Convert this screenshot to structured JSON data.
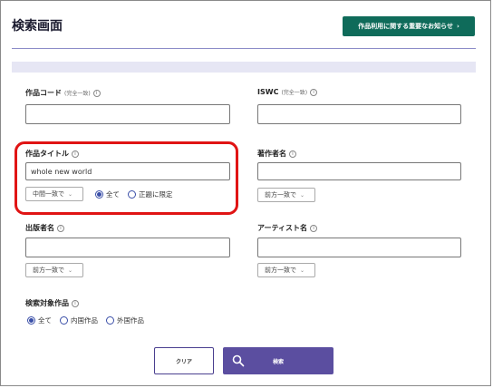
{
  "header": {
    "title": "検索画面",
    "notice_button": "作品利用に関する重要なお知らせ",
    "notice_arrow": "›"
  },
  "form": {
    "info_glyph": "i",
    "work_code": {
      "label": "作品コード",
      "note": "(完全一致)",
      "value": ""
    },
    "iswc": {
      "label": "ISWC",
      "note": "(完全一致)",
      "value": ""
    },
    "work_title": {
      "label": "作品タイトル",
      "value": "whole new world",
      "match_select": "中間一致で",
      "options": [
        "全て",
        "正題に限定"
      ],
      "selected": "全て"
    },
    "author": {
      "label": "著作者名",
      "value": "",
      "match_select": "前方一致で"
    },
    "publisher": {
      "label": "出版者名",
      "value": "",
      "match_select": "前方一致で"
    },
    "artist": {
      "label": "アーティスト名",
      "value": "",
      "match_select": "前方一致で"
    },
    "target": {
      "label": "検索対象作品",
      "options": [
        "全て",
        "内国作品",
        "外国作品"
      ],
      "selected": "全て"
    },
    "select_chevron": "⌄"
  },
  "actions": {
    "clear": "クリア",
    "search": "検索"
  },
  "colors": {
    "notice_bg": "#0f6b5a",
    "search_bg": "#5b4ea0",
    "highlight": "#e01414",
    "radio": "#3a4fa8"
  }
}
